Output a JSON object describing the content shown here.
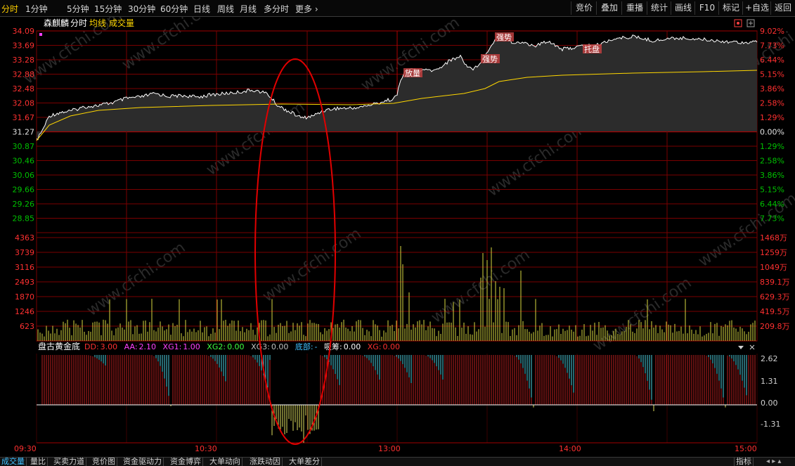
{
  "toolbar": {
    "period_tabs": [
      "分时",
      "1分钟",
      "5分钟",
      "15分钟",
      "30分钟",
      "60分钟",
      "日线",
      "周线",
      "月线",
      "多分时",
      "更多"
    ],
    "right_buttons": [
      "竞价",
      "叠加",
      "重播",
      "统计",
      "画线",
      "F10",
      "标记",
      "+自选",
      "返回"
    ]
  },
  "main_chart": {
    "stock_name": "森麒麟",
    "legend": [
      "分时",
      "均线",
      "成交量"
    ],
    "y_labels_left": [
      "34.09",
      "33.69",
      "33.28",
      "32.88",
      "32.48",
      "32.08",
      "31.67",
      "31.27",
      "30.87",
      "30.46",
      "30.06",
      "29.66",
      "29.26",
      "28.85"
    ],
    "y_labels_right": [
      "9.02%",
      "7.73%",
      "6.44%",
      "5.15%",
      "3.86%",
      "2.58%",
      "1.29%",
      "0.00%",
      "1.29%",
      "2.58%",
      "3.86%",
      "5.15%",
      "6.44%",
      "7.73%"
    ],
    "annotations": [
      "放量",
      "强势",
      "强势",
      "托盘"
    ],
    "colors": {
      "price_line": "#ffffff",
      "avg_line": "#ffd700",
      "up": "#ff3030",
      "down": "#00c000",
      "grid": "#7a0000"
    }
  },
  "volume_chart": {
    "y_labels_left": [
      "4363",
      "3739",
      "3116",
      "2493",
      "1870",
      "1246",
      "623"
    ],
    "y_labels_right": [
      "1468万",
      "1259万",
      "1049万",
      "839.1万",
      "629.3万",
      "419.5万",
      "209.8万"
    ]
  },
  "indicator": {
    "name": "盘古黄金底",
    "params": [
      {
        "label": "DD:",
        "value": "3.00"
      },
      {
        "label": "AA:",
        "value": "2.10"
      },
      {
        "label": "XG1:",
        "value": "1.00"
      },
      {
        "label": "XG2:",
        "value": "0.00"
      },
      {
        "label": "XG3:",
        "value": "0.00"
      },
      {
        "label": "底部:",
        "value": "-"
      },
      {
        "label": "吸筹:",
        "value": "0.00"
      },
      {
        "label": "XG:",
        "value": "0.00"
      }
    ],
    "y_labels_right": [
      "2.62",
      "1.31",
      "0.00",
      "-1.31"
    ]
  },
  "time_axis": [
    "09:30",
    "10:30",
    "13:00",
    "14:00",
    "15:00"
  ],
  "bottom_tabs": [
    "成交量",
    "量比",
    "买卖力道",
    "竞价图",
    "资金驱动力",
    "资金博弈",
    "大单动向",
    "涨跌动因",
    "大单差分"
  ],
  "bottom_right": "指标",
  "watermark": "www.cfchi.com"
}
